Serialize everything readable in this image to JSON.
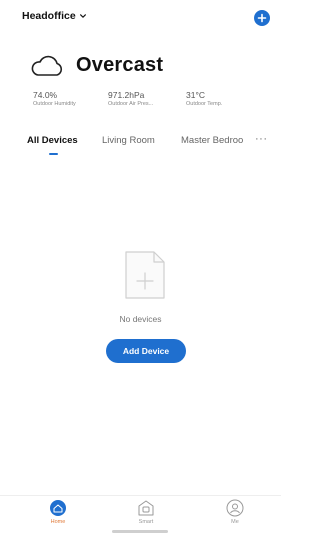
{
  "header": {
    "home_name": "Headoffice"
  },
  "weather": {
    "condition": "Overcast",
    "stats": [
      {
        "value": "74.0%",
        "label": "Outdoor Humidity"
      },
      {
        "value": "971.2hPa",
        "label": "Outdoor Air Pres..."
      },
      {
        "value": "31°C",
        "label": "Outdoor Temp."
      }
    ]
  },
  "tabs": [
    {
      "label": "All Devices",
      "active": true
    },
    {
      "label": "Living Room",
      "active": false
    },
    {
      "label": "Master Bedroo",
      "active": false
    }
  ],
  "more_label": "···",
  "empty_state": {
    "message": "No devices",
    "button_label": "Add Device"
  },
  "bottom_nav": [
    {
      "label": "Home",
      "active": true,
      "icon": "home-icon"
    },
    {
      "label": "Smart",
      "active": false,
      "icon": "smart-icon"
    },
    {
      "label": "Me",
      "active": false,
      "icon": "profile-icon"
    }
  ],
  "colors": {
    "accent": "#1f6fcf",
    "active_nav": "#e07a3a"
  }
}
